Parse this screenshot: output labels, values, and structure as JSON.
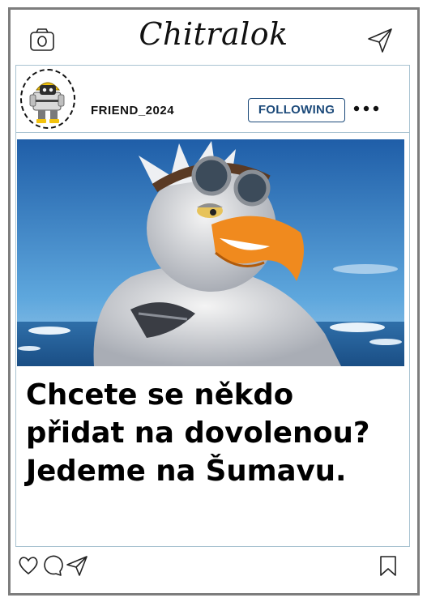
{
  "header": {
    "app_title": "Chitralok",
    "left_icon": "camera-icon",
    "right_icon": "send-icon"
  },
  "profile": {
    "username": "FRIEND_2024",
    "follow_label": "FOLLOWING",
    "more_icon": "more-dots-icon"
  },
  "post": {
    "caption": "Chcete se někdo přidat na dovolenou? Jedeme na Šumavu."
  },
  "actions": {
    "icons": [
      "heart-icon",
      "comment-icon",
      "share-icon",
      "bookmark-icon"
    ]
  },
  "colors": {
    "frame": "#7d7d7d",
    "rule": "#a9c3d1",
    "accent": "#1c4a7a",
    "sky": "#3a86c8",
    "beak": "#f08a1e"
  }
}
